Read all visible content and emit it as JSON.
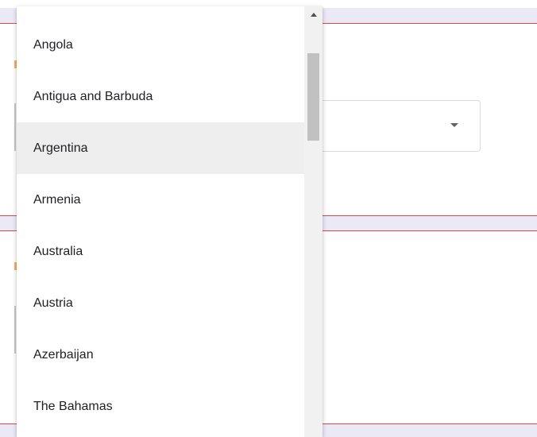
{
  "dropdown": {
    "options": [
      {
        "label": "Angola"
      },
      {
        "label": "Antigua and Barbuda"
      },
      {
        "label": "Argentina"
      },
      {
        "label": "Armenia"
      },
      {
        "label": "Australia"
      },
      {
        "label": "Austria"
      },
      {
        "label": "Azerbaijan"
      },
      {
        "label": "The Bahamas"
      }
    ],
    "highlighted_label": "Argentina"
  },
  "scrollbar": {
    "up_arrow_icon": "chevron-up-icon",
    "position_fraction": 0.1
  },
  "select": {
    "arrow_icon": "caret-down-icon"
  },
  "colors": {
    "band": "#ece9f7",
    "band_line": "#e04848",
    "highlight": "#eeeeee",
    "scroll_thumb": "#c1c1c1",
    "accent": "#f6b26b"
  }
}
